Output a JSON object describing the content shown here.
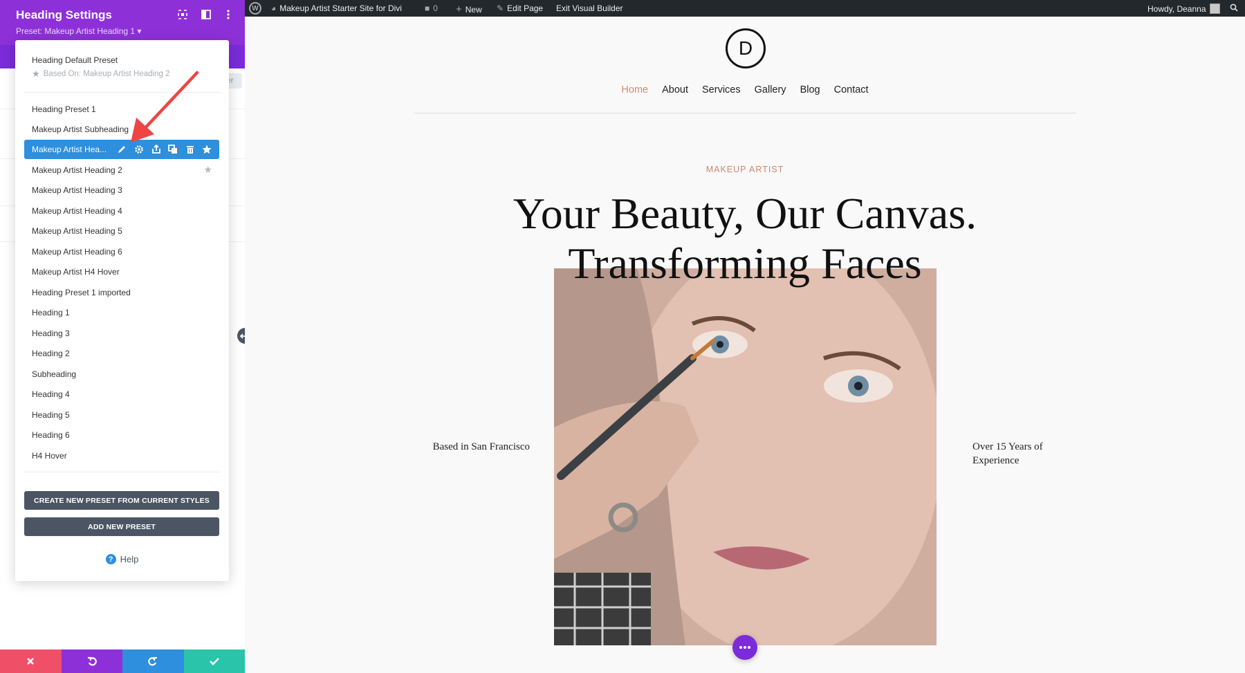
{
  "panel": {
    "title": "Heading Settings",
    "preset_label": "Preset: Makeup Artist Heading 1 ▾",
    "behind_tab": "er"
  },
  "dropdown": {
    "default_preset": "Heading Default Preset",
    "based_on": "Based On: Makeup Artist Heading 2",
    "active_item": "Makeup Artist Hea...",
    "items": [
      "Heading Preset 1",
      "Makeup Artist Subheading",
      "Makeup Artist Heading 2",
      "Makeup Artist Heading 3",
      "Makeup Artist Heading 4",
      "Makeup Artist Heading 5",
      "Makeup Artist Heading 6",
      "Makeup Artist H4 Hover",
      "Heading Preset 1 imported",
      "Heading 1",
      "Heading 3",
      "Heading 2",
      "Subheading",
      "Heading 4",
      "Heading 5",
      "Heading 6",
      "H4 Hover"
    ],
    "create_button": "CREATE NEW PRESET FROM CURRENT STYLES",
    "add_button": "ADD NEW PRESET",
    "help": "Help"
  },
  "adminbar": {
    "site_name": "Makeup Artist Starter Site for Divi",
    "comments_count": "0",
    "new": "New",
    "edit_page": "Edit Page",
    "exit_builder": "Exit Visual Builder",
    "greeting": "Howdy, Deanna"
  },
  "site": {
    "logo_letter": "D",
    "nav": [
      "Home",
      "About",
      "Services",
      "Gallery",
      "Blog",
      "Contact"
    ],
    "eyebrow": "MAKEUP ARTIST",
    "title_line1": "Your Beauty, Our Canvas.",
    "title_line2": "Transforming Faces",
    "left_text": "Based in San Francisco",
    "right_text": "Over 15 Years of Experience"
  },
  "colors": {
    "panel_header": "#8e30d8",
    "active_blue": "#2d8fdd",
    "nav_active": "#d08b6f",
    "cancel": "#ef5067",
    "save": "#29c4a9"
  }
}
